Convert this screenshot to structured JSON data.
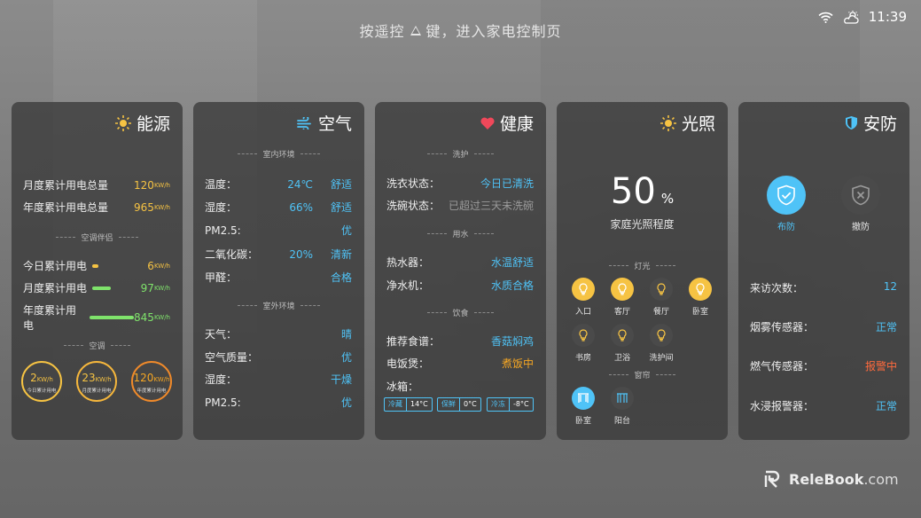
{
  "top_hint": {
    "prefix": "按遥控",
    "suffix": "键，进入家电控制页"
  },
  "status": {
    "time": "11:39"
  },
  "energy": {
    "title": "能源",
    "rows": [
      {
        "label": "月度累计用电总量",
        "value": "120",
        "unit": "KW/h"
      },
      {
        "label": "年度累计用电总量",
        "value": "965",
        "unit": "KW/h"
      }
    ],
    "section_ac": "空调伴侣",
    "bars": [
      {
        "label": "今日累计用电",
        "value": "6",
        "unit": "KW/h",
        "level": 0.08,
        "color": "#f6c343"
      },
      {
        "label": "月度累计用电",
        "value": "97",
        "unit": "KW/h",
        "level": 0.4,
        "color": "#7fe36b"
      },
      {
        "label": "年度累计用电",
        "value": "845",
        "unit": "KW/h",
        "level": 1.0,
        "color": "#7fe36b"
      }
    ],
    "section_air": "空调",
    "rings": [
      {
        "value": "2",
        "unit": "KW/h",
        "label": "今日累计用电"
      },
      {
        "value": "23",
        "unit": "KW/h",
        "label": "月度累计用电"
      },
      {
        "value": "120",
        "unit": "KW/h",
        "label": "年度累计用电"
      }
    ]
  },
  "air": {
    "title": "空气",
    "section_in": "室内环境",
    "indoor": [
      {
        "label": "温度：",
        "v1": "24℃",
        "v2": "舒适"
      },
      {
        "label": "湿度：",
        "v1": "66%",
        "v2": "舒适"
      },
      {
        "label": "PM2.5:",
        "v1": "",
        "v2": "优"
      },
      {
        "label": "二氧化碳：",
        "v1": "20%",
        "v2": "清新"
      },
      {
        "label": "甲醛：",
        "v1": "",
        "v2": "合格"
      }
    ],
    "section_out": "室外环境",
    "outdoor": [
      {
        "label": "天气：",
        "value": "晴"
      },
      {
        "label": "空气质量：",
        "value": "优"
      },
      {
        "label": "湿度：",
        "value": "干燥"
      },
      {
        "label": "PM2.5:",
        "value": "优"
      }
    ]
  },
  "health": {
    "title": "健康",
    "section_wash": "洗护",
    "wash": [
      {
        "label": "洗衣状态：",
        "value": "今日已清洗"
      },
      {
        "label": "洗碗状态：",
        "value": "已超过三天未洗碗"
      }
    ],
    "section_water": "用水",
    "water": [
      {
        "label": "热水器：",
        "value": "水温舒适"
      },
      {
        "label": "净水机：",
        "value": "水质合格"
      }
    ],
    "section_food": "饮食",
    "food": [
      {
        "label": "推荐食谱：",
        "value": "香菇焖鸡"
      },
      {
        "label": "电饭煲：",
        "value": "煮饭中"
      }
    ],
    "fridge_label": "冰箱：",
    "fridge": [
      {
        "name": "冷藏",
        "temp": "14°C"
      },
      {
        "name": "保鲜",
        "temp": "0°C"
      },
      {
        "name": "冷冻",
        "temp": "-8°C"
      }
    ]
  },
  "light": {
    "title": "光照",
    "percent": "50",
    "percent_sign": "%",
    "caption": "家庭光照程度",
    "section_lamps": "灯光",
    "lamps": [
      {
        "name": "入口",
        "on": true
      },
      {
        "name": "客厅",
        "on": true
      },
      {
        "name": "餐厅",
        "on": false
      },
      {
        "name": "卧室",
        "on": true
      },
      {
        "name": "书房",
        "on": false
      },
      {
        "name": "卫浴",
        "on": false
      },
      {
        "name": "洗护间",
        "on": false
      }
    ],
    "section_curtain": "窗帘",
    "curtains": [
      {
        "name": "卧室",
        "on": true
      },
      {
        "name": "阳台",
        "on": false
      }
    ]
  },
  "security": {
    "title": "安防",
    "arm": "布防",
    "disarm": "撤防",
    "rows": [
      {
        "label": "来访次数：",
        "value": "12"
      },
      {
        "label": "烟雾传感器：",
        "value": "正常"
      },
      {
        "label": "燃气传感器：",
        "value": "报警中"
      },
      {
        "label": "水浸报警器：",
        "value": "正常"
      }
    ]
  },
  "watermark": {
    "brand": "ReleBook",
    "tld": ".com"
  },
  "colors": {
    "accent": "#4fc3f7",
    "warn": "#ff6a3d",
    "amber": "#f6c343",
    "green": "#7fe36b"
  }
}
